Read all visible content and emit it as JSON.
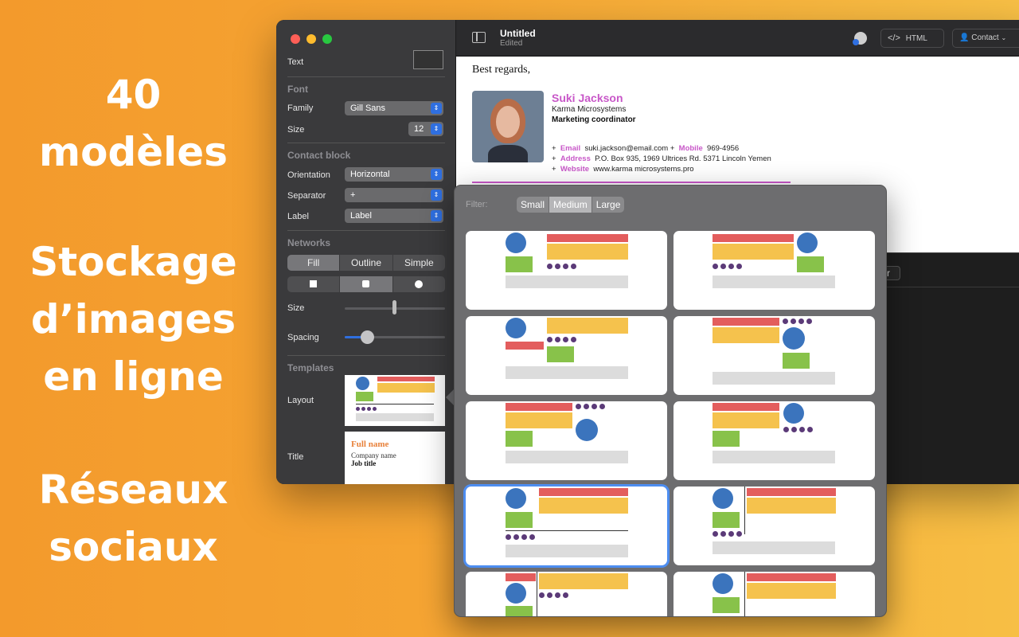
{
  "promo": {
    "line1": "40",
    "line2": "modèles",
    "line3": "Stockage",
    "line4": "d’images",
    "line5": "en ligne",
    "line6": "Réseaux",
    "line7": "sociaux"
  },
  "toolbar": {
    "title": "Untitled",
    "subtitle": "Edited",
    "html_label": "HTML",
    "contact_label": "Contact"
  },
  "sidebar": {
    "text_label": "Text",
    "font_section": "Font",
    "family_label": "Family",
    "family_value": "Gill Sans",
    "size_label": "Size",
    "size_value": "12",
    "contact_section": "Contact block",
    "orientation_label": "Orientation",
    "orientation_value": "Horizontal",
    "separator_label": "Separator",
    "separator_value": "+",
    "label_label": "Label",
    "label_value": "Label",
    "networks_section": "Networks",
    "style_tabs": [
      "Fill",
      "Outline",
      "Simple"
    ],
    "net_size_label": "Size",
    "spacing_label": "Spacing",
    "templates_section": "Templates",
    "layout_label": "Layout",
    "title_label": "Title",
    "title_preview": {
      "name": "Full name",
      "company": "Company name",
      "job": "Job title"
    }
  },
  "signature": {
    "greeting": "Best regards,",
    "name": "Suki Jackson",
    "company": "Karma Microsystems",
    "role": "Marketing coordinator",
    "sep": "+",
    "email_label": "Email",
    "email": "suki.jackson@email.com",
    "mobile_label": "Mobile",
    "mobile": "969-4956",
    "address_label": "Address",
    "address": "P.O. Box 935, 1969 Ultrices Rd. 5371 Lincoln Yemen",
    "website_label": "Website",
    "website": "www.karma microsystems.pro"
  },
  "lower": {
    "partial_button": "ter"
  },
  "popover": {
    "filter_label": "Filter:",
    "filter_options": [
      "Small",
      "Medium",
      "Large"
    ],
    "filter_selected": "Medium"
  },
  "colors": {
    "accent_pink": "#c857c8",
    "title_orange": "#e8813a",
    "selection_blue": "#4d8df0",
    "template_red": "#e35d5d",
    "template_yellow": "#f5c24d",
    "template_green": "#88c24a",
    "template_blue": "#3b74bd",
    "template_purple": "#5b3a78"
  }
}
